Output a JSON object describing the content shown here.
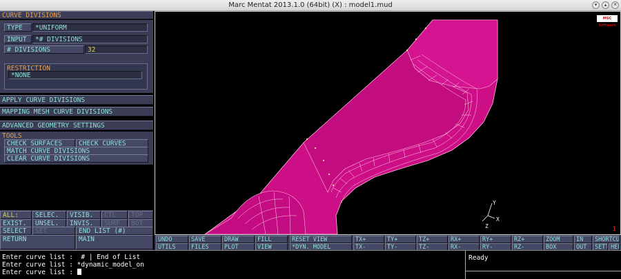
{
  "window": {
    "title": "Marc Mentat 2013.1.0 (64bit) (X) : model1.mud"
  },
  "panel": {
    "header": "CURVE DIVISIONS",
    "type_label": "TYPE",
    "type_value": "*UNIFORM",
    "input_label": "INPUT",
    "input_value": "*# DIVISIONS",
    "divisions_label": "# DIVISIONS",
    "divisions_value": "32",
    "restriction_label": "RESTRICTION",
    "restriction_value": "*NONE",
    "apply": "APPLY CURVE DIVISIONS",
    "mapping": "MAPPING MESH CURVE DIVISIONS",
    "advanced": "ADVANCED GEOMETRY SETTINGS",
    "tools_label": "TOOLS",
    "check_surfaces": "CHECK SURFACES",
    "check_curves": "CHECK CURVES",
    "match": "MATCH CURVE DIVISIONS",
    "clear": "CLEAR CURVE DIVISIONS"
  },
  "select": {
    "all": "ALL:",
    "selec": "SELEC.",
    "visib": "VISIB.",
    "ctl": "CTL",
    "top": "TOP",
    "exist": "EXIST.",
    "unsel": "UNSEL.",
    "invis": "INVIS.",
    "surf": "SURF",
    "bot": "BOT",
    "select": "SELECT",
    "set": "SET",
    "end_list": "END LIST (#)",
    "return": "RETURN",
    "main": "MAIN"
  },
  "toolbar": {
    "row1": [
      "UNDO",
      "SAVE",
      "DRAW",
      "FILL",
      "RESET VIEW",
      "TX+",
      "TY+",
      "TZ+",
      "RX+",
      "RY+",
      "RZ+",
      "ZOOM",
      "IN",
      "SHORTCUTS"
    ],
    "row2": [
      "UTILS",
      "FILES",
      "PLOT",
      "VIEW",
      "*DYN. MODEL",
      "TX-",
      "TY-",
      "TZ-",
      "RX-",
      "RY-",
      "RZ-",
      "BOX",
      "OUT",
      "SETTINGS",
      "HELP"
    ]
  },
  "viewport": {
    "logo": "MSC Software",
    "number": "1",
    "axes": {
      "x": "X",
      "y": "Y",
      "z": "Z"
    }
  },
  "command": {
    "line1": "Enter curve list :  # | End of List",
    "line2": "Enter curve list : *dynamic_model_on",
    "line3": "Enter curve list :"
  },
  "status": {
    "text": "Ready"
  }
}
